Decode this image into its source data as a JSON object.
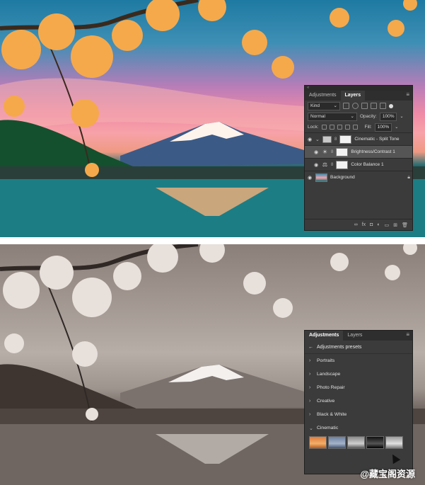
{
  "layers_panel": {
    "tabs": [
      "Adjustments",
      "Layers"
    ],
    "filter_kind": "Kind",
    "blend_mode": "Normal",
    "opacity_label": "Opacity:",
    "opacity_value": "100%",
    "lock_label": "Lock:",
    "fill_label": "Fill:",
    "fill_value": "100%",
    "layers": [
      {
        "name": "Cinematic - Split Tone",
        "type": "group"
      },
      {
        "name": "Brightness/Contrast 1",
        "type": "adjustment",
        "icon": "brightness-icon"
      },
      {
        "name": "Color Balance 1",
        "type": "adjustment",
        "icon": "balance-icon"
      },
      {
        "name": "Background",
        "type": "image"
      }
    ]
  },
  "adjustments_panel": {
    "tabs": [
      "Adjustments",
      "Layers"
    ],
    "header": "Adjustments presets",
    "categories": [
      "Portraits",
      "Landscape",
      "Photo Repair",
      "Creative",
      "Black & White",
      "Cinematic"
    ],
    "preset_colors": [
      "#e07a3a",
      "#6b7fa0",
      "#8a8a8a",
      "#111111",
      "#9c9c9c"
    ]
  },
  "watermark": {
    "text": "@藏宝阁资源"
  }
}
